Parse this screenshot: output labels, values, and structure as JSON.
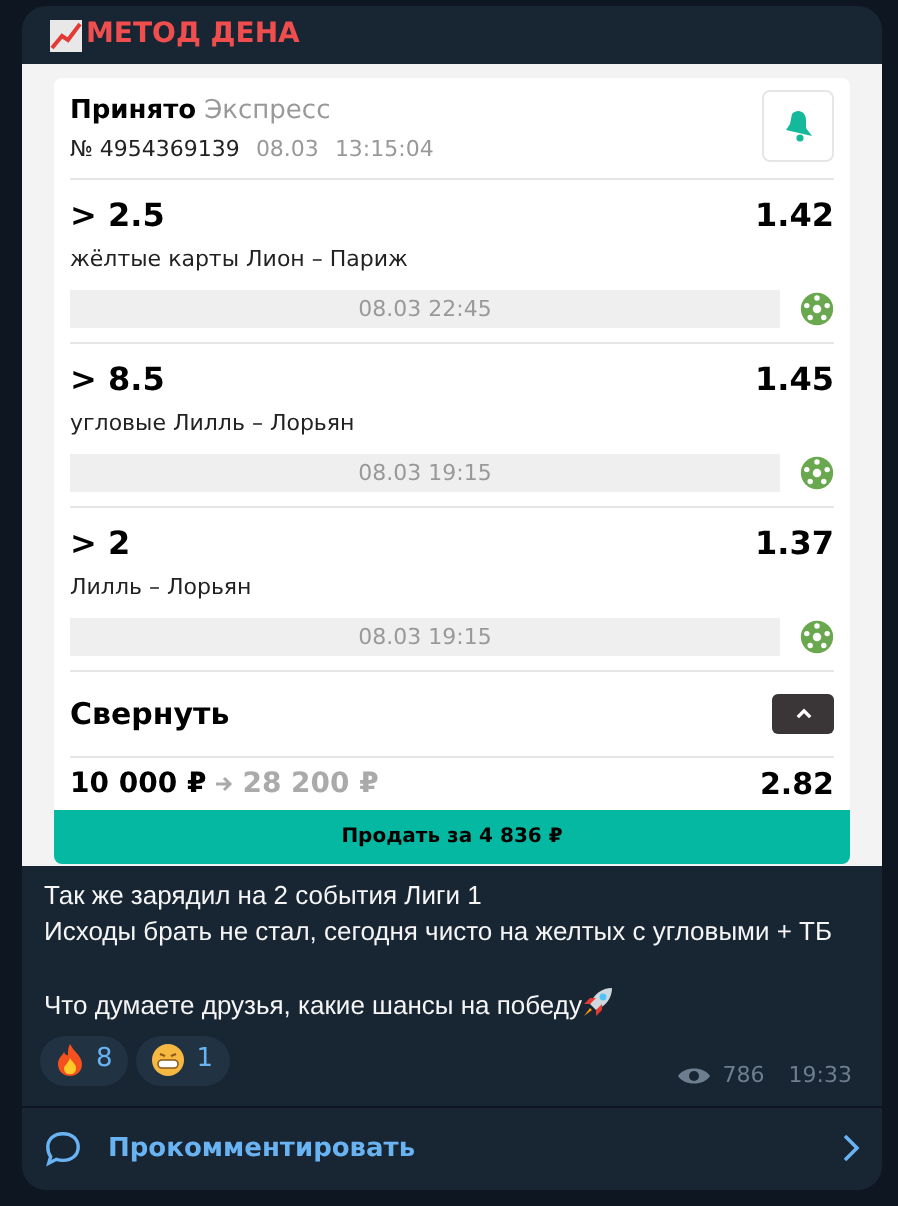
{
  "channel": {
    "name": "МЕТОД ДЕНА"
  },
  "bet_slip": {
    "status": "Принято",
    "type": "Экспресс",
    "number": "№ 4954369139",
    "date": "08.03",
    "time": "13:15:04",
    "bets": [
      {
        "selection": "> 2.5",
        "odds": "1.42",
        "event": "жёлтые карты Лион – Париж",
        "datetime": "08.03 22:45"
      },
      {
        "selection": "> 8.5",
        "odds": "1.45",
        "event": "угловые Лилль – Лорьян",
        "datetime": "08.03 19:15"
      },
      {
        "selection": "> 2",
        "odds": "1.37",
        "event": "Лилль – Лорьян",
        "datetime": "08.03 19:15"
      }
    ],
    "collapse": {
      "label": "Свернуть",
      "expanded": true
    },
    "stake": "10 000 ₽",
    "payout": "28 200 ₽",
    "total_odds": "2.82",
    "sell_button": "Продать за 4 836 ₽"
  },
  "message": {
    "lines": [
      {
        "text": "Так же зарядил на 2 события Лиги 1",
        "gap_before": false
      },
      {
        "text": "Исходы брать не стал, сегодня чисто на желтых с угловыми + ТБ",
        "gap_before": false
      },
      {
        "text": "Что думаете друзья, какие шансы на победу",
        "gap_before": true
      }
    ]
  },
  "reactions": [
    {
      "kind": "fire",
      "count": "8"
    },
    {
      "kind": "grin",
      "count": "1"
    }
  ],
  "views": "786",
  "time": "19:33",
  "comment_button": "Прокомментировать"
}
